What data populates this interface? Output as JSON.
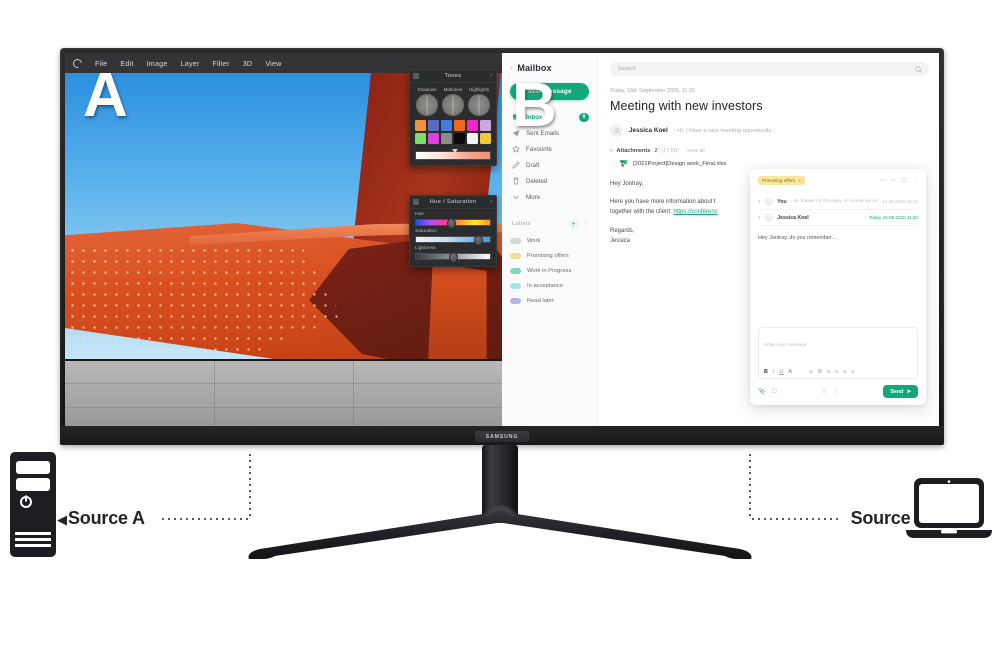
{
  "product": {
    "brand": "SAMSUNG",
    "letter_a": "A",
    "letter_b": "B",
    "source_a_label": "Source A",
    "source_b_label": "Source B",
    "arrow_left": "◀",
    "arrow_right": "▶",
    "device_a_icon": "desktop-tower-icon",
    "device_b_icon": "laptop-icon"
  },
  "app_a": {
    "name": "photo-editor",
    "menu": [
      {
        "label": "File"
      },
      {
        "label": "Edit"
      },
      {
        "label": "Image"
      },
      {
        "label": "Layer"
      },
      {
        "label": "Filter"
      },
      {
        "label": "3D"
      },
      {
        "label": "View"
      }
    ],
    "panels": {
      "tones": {
        "title": "Tones",
        "close": "×",
        "wheels": [
          {
            "label": "Shadows"
          },
          {
            "label": "Midtones"
          },
          {
            "label": "Highlights"
          }
        ],
        "swatches_row1": [
          "#f0913f",
          "#5a6bc4",
          "#3f7fe0",
          "#ef6a1f",
          "#ef26c6",
          "#cfa5dd"
        ],
        "swatches_row2": [
          "#7ae063",
          "#e23ee0",
          "#8b8c90",
          "#0c0c0e",
          "#f4f4f2",
          "#f2c93a"
        ],
        "slider_gradient_from": "#ffffff",
        "slider_gradient_to": "#ef8f78"
      },
      "hue_saturation": {
        "title": "Hue / Saturation",
        "close": "×",
        "sliders": [
          {
            "label": "Hue",
            "knob_pct": 44
          },
          {
            "label": "Saturation",
            "knob_pct": 80
          },
          {
            "label": "Lightness",
            "knob_pct": 46
          }
        ]
      }
    },
    "artwork": {
      "description": "orange perforated architectural sculpture against blue sky with concrete pavement"
    }
  },
  "app_b": {
    "name": "mailbox",
    "sidebar": {
      "back_icon": "chevron-left-icon",
      "title": "Mailbox",
      "new_message": "New message",
      "items": [
        {
          "label": "Inbox",
          "icon": "inbox-icon",
          "badge": "8",
          "active": true
        },
        {
          "label": "Sent Emails",
          "icon": "send-icon",
          "badge": "",
          "active": false
        },
        {
          "label": "Favourite",
          "icon": "star-icon",
          "badge": "",
          "active": false
        },
        {
          "label": "Draft",
          "icon": "pencil-icon",
          "badge": "",
          "active": false
        },
        {
          "label": "Deleted",
          "icon": "trash-icon",
          "badge": "",
          "active": false
        },
        {
          "label": "More",
          "icon": "chevron-down-icon",
          "badge": "",
          "active": false
        }
      ],
      "labels_header": "Labels",
      "labels_add": "+",
      "labels_menu": "⋮",
      "labels": [
        {
          "label": "Work",
          "color": "#d6d7da"
        },
        {
          "label": "Promising offers",
          "color": "#f2dc9a"
        },
        {
          "label": "Work in Progress",
          "color": "#7fd9c0"
        },
        {
          "label": "In acceptance",
          "color": "#a8e3ea"
        },
        {
          "label": "Read later",
          "color": "#b8b2ea"
        }
      ]
    },
    "search": {
      "placeholder": "Search",
      "icon": "search-icon"
    },
    "mail": {
      "date": "Today, 16th September 2020, 11:26",
      "subject": "Meeting with new investors",
      "sender": "Jessica Koel",
      "snippet": "- Hi, I have a new meeting opportunity...",
      "attachments_label": "Attachments",
      "attachments_count": "2",
      "attachments_size": "(17 KB)",
      "save_all": "save all",
      "attachment_name": "[2021Project]Design work_Final.xlsx",
      "greeting": "Hey Jontray,",
      "body_line1": "Here you have more information about t",
      "body_line2": "together with the client:",
      "body_link": "https://conferenc",
      "sign_off": "Regards,",
      "signature": "Jessica"
    },
    "popup": {
      "tag": "Promising offers",
      "tag_close": "×",
      "icons": [
        "reply-icon",
        "forward-icon",
        "archive-icon",
        "more-icon"
      ],
      "thread": [
        {
          "name": "You",
          "snippet": "- Hi, thanks for the reply, of course we need to...",
          "time": "14.09.2020 18:31",
          "green": false
        },
        {
          "name": "Jessica Koel",
          "snippet": "",
          "time": "Today 16.09.2020 11:26",
          "green": true
        }
      ],
      "body": "Hey Jontray, do you remember...",
      "composer_placeholder": "Write your message",
      "format_tools": [
        "B",
        "I",
        "U",
        "A"
      ],
      "format_tools2": [
        "list-icon",
        "numbered-list-icon",
        "align-left-icon",
        "align-center-icon",
        "align-right-icon",
        "align-justify-icon"
      ],
      "attach_icon": "paperclip-icon",
      "image_icon": "image-icon",
      "emoji_icon": "emoji-icon",
      "more_icon": "more-icon",
      "send_label": "Send",
      "send_icon": "paper-plane-icon"
    }
  },
  "colors": {
    "accent_green": "#12a87a",
    "bezel_dark": "#1d1e20",
    "label_yellow": "#fbe6a0"
  }
}
